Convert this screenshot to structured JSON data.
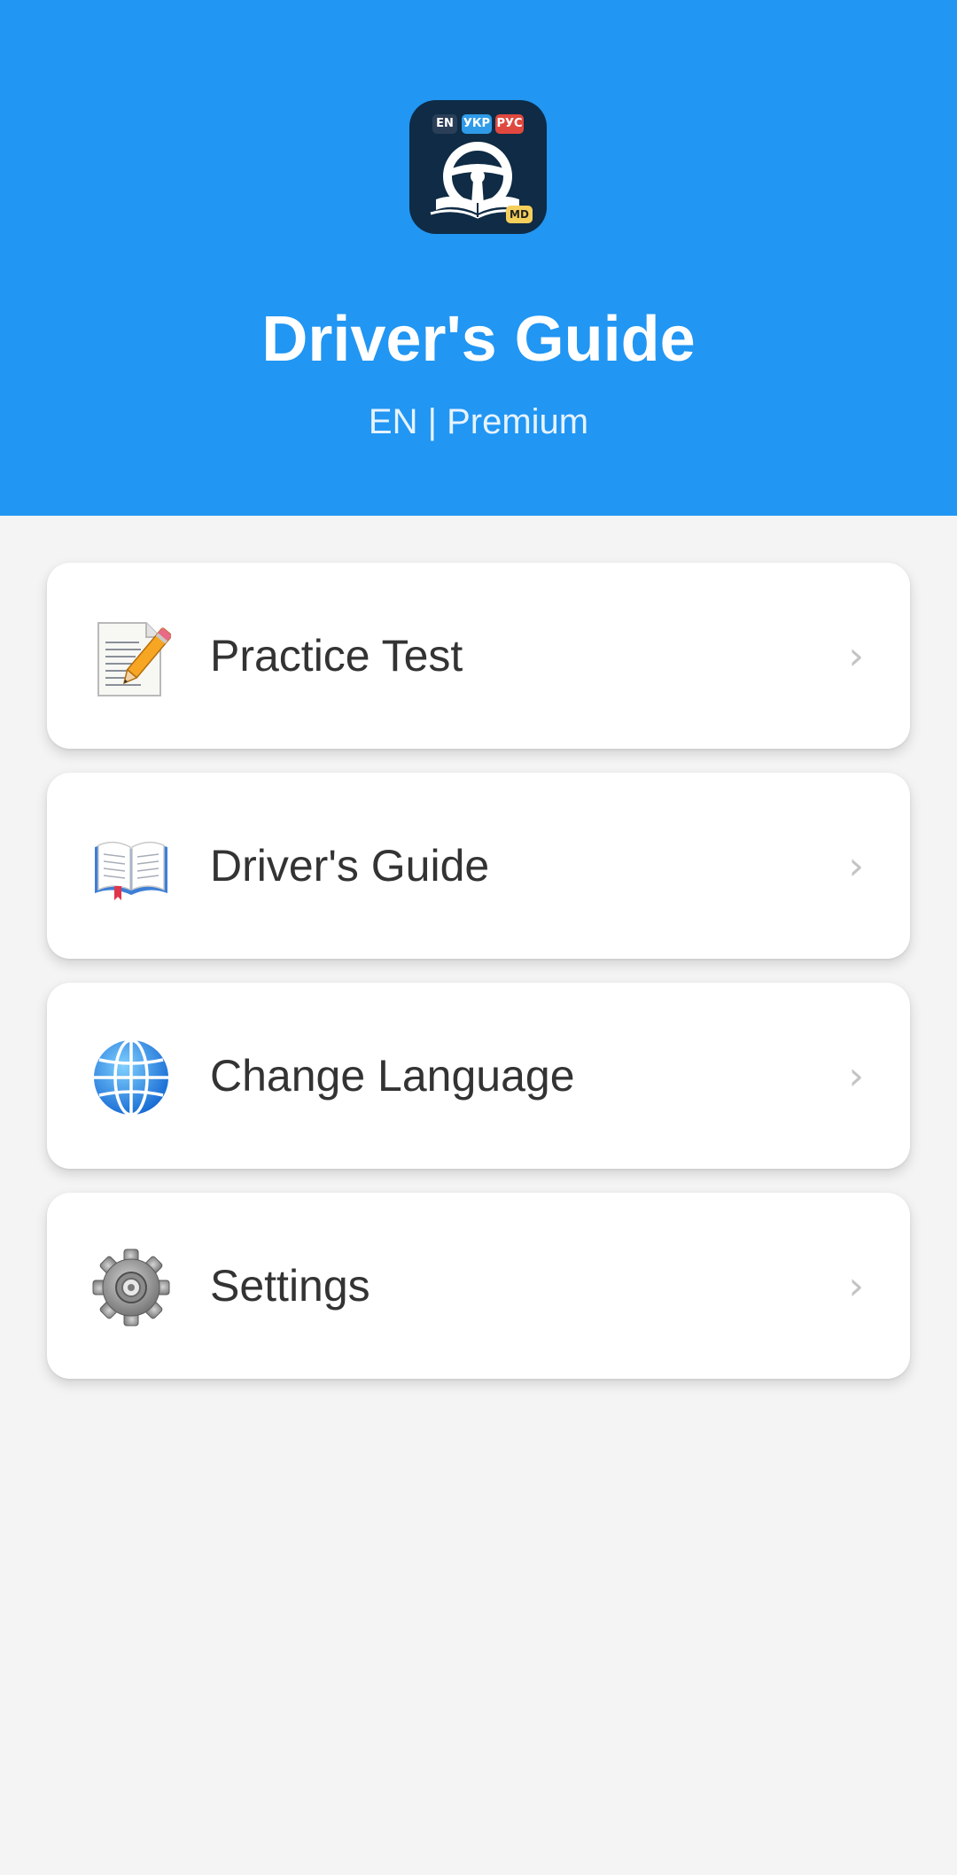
{
  "header": {
    "logo": {
      "badges": [
        "EN",
        "УКР",
        "РУС"
      ],
      "corner_badge": "MD",
      "icon": "steering-wheel-book-icon"
    },
    "title": "Driver's Guide",
    "subtitle": "EN | Premium",
    "background_color": "#2196f3"
  },
  "menu": {
    "items": [
      {
        "label": "Practice Test",
        "icon": "memo-pencil-icon"
      },
      {
        "label": "Driver's Guide",
        "icon": "open-book-icon"
      },
      {
        "label": "Change Language",
        "icon": "globe-icon"
      },
      {
        "label": "Settings",
        "icon": "gear-icon"
      }
    ],
    "chevron": "›"
  },
  "colors": {
    "accent": "#2196f3",
    "background": "#f4f4f4",
    "card": "#ffffff",
    "text": "#333333"
  }
}
